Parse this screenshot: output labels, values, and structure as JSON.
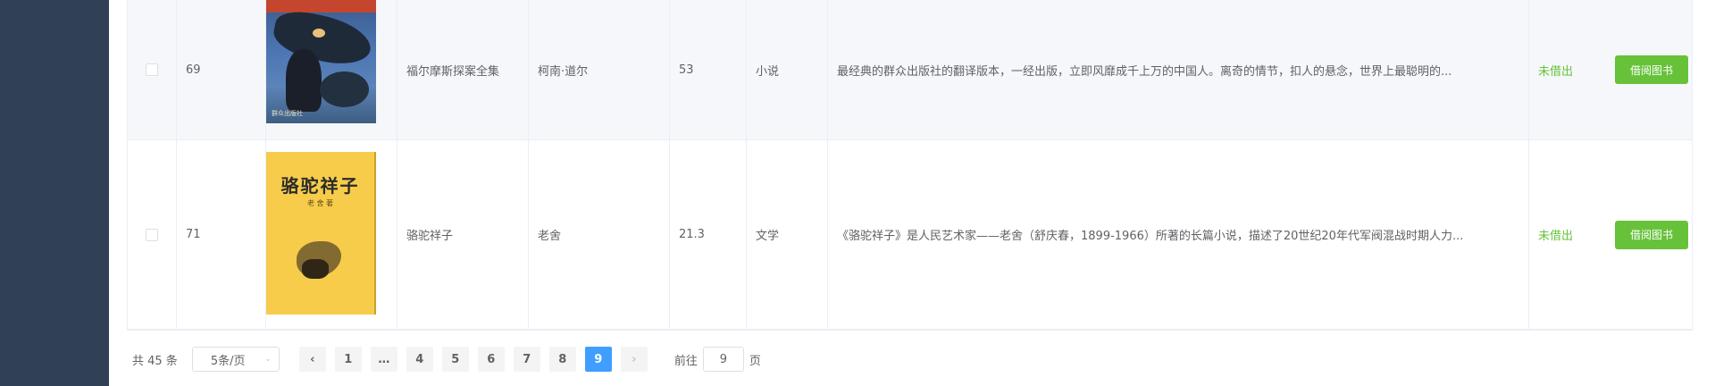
{
  "table": {
    "rows": [
      {
        "id": "69",
        "cover_icon": "book-cover-sherlock-holmes",
        "cover_publisher": "群众出版社",
        "title": "福尔摩斯探案全集",
        "author": "柯南·道尔",
        "price": "53",
        "category": "小说",
        "description": "最经典的群众出版社的翻译版本，一经出版，立即风靡成千上万的中国人。离奇的情节，扣人的悬念，世界上最聪明的...",
        "status": "未借出",
        "action_label": "借阅图书"
      },
      {
        "id": "71",
        "cover_icon": "book-cover-luotuo-xiangzi",
        "cover_title": "骆驼祥子",
        "cover_author": "老 舍 著",
        "title": "骆驼祥子",
        "author": "老舍",
        "price": "21.3",
        "category": "文学",
        "description": "《骆驼祥子》是人民艺术家——老舍（舒庆春，1899-1966）所著的长篇小说，描述了20世纪20年代军阀混战时期人力...",
        "status": "未借出",
        "action_label": "借阅图书"
      }
    ]
  },
  "pagination": {
    "total": "共 45 条",
    "page_size": "5条/页",
    "prev_icon": "chevron-left-icon",
    "next_icon": "chevron-right-icon",
    "pages": [
      "1",
      "…",
      "4",
      "5",
      "6",
      "7",
      "8",
      "9"
    ],
    "current_page": "9",
    "goto_label": "前往",
    "goto_value": "9",
    "page_suffix": "页"
  },
  "colors": {
    "sidebar": "#304156",
    "status_available": "#67c23a",
    "borrow_button": "#67c23a",
    "active_page": "#409eff"
  }
}
